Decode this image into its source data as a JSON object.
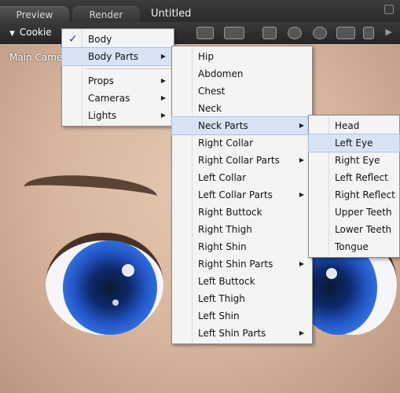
{
  "tabs": {
    "preview": "Preview",
    "render": "Render",
    "document_title": "Untitled"
  },
  "toolbar": {
    "camera_label": "Cookie"
  },
  "viewport": {
    "label": "Main Camera"
  },
  "menu1": {
    "items": [
      {
        "label": "Body",
        "checked": true
      },
      {
        "label": "Body Parts",
        "submenu": true,
        "highlighted": true
      },
      {
        "label": "Props",
        "submenu": true
      },
      {
        "label": "Cameras",
        "submenu": true
      },
      {
        "label": "Lights",
        "submenu": true
      }
    ]
  },
  "menu2": {
    "items": [
      {
        "label": "Hip"
      },
      {
        "label": "Abdomen"
      },
      {
        "label": "Chest"
      },
      {
        "label": "Neck"
      },
      {
        "label": "Neck Parts",
        "submenu": true,
        "highlighted": true
      },
      {
        "label": "Right Collar"
      },
      {
        "label": "Right Collar Parts",
        "submenu": true
      },
      {
        "label": "Left Collar"
      },
      {
        "label": "Left Collar Parts",
        "submenu": true
      },
      {
        "label": "Right Buttock"
      },
      {
        "label": "Right Thigh"
      },
      {
        "label": "Right Shin"
      },
      {
        "label": "Right Shin Parts",
        "submenu": true
      },
      {
        "label": "Left Buttock"
      },
      {
        "label": "Left Thigh"
      },
      {
        "label": "Left Shin"
      },
      {
        "label": "Left Shin Parts",
        "submenu": true
      }
    ]
  },
  "menu3": {
    "items": [
      {
        "label": "Head"
      },
      {
        "label": "Left Eye",
        "highlighted": true
      },
      {
        "label": "Right Eye"
      },
      {
        "label": "Left Reflect"
      },
      {
        "label": "Right Reflect"
      },
      {
        "label": "Upper Teeth"
      },
      {
        "label": "Lower Teeth"
      },
      {
        "label": "Tongue"
      }
    ]
  },
  "icons": {
    "check": "✓",
    "submenu_arrow": "▶",
    "dropdown": "▼",
    "more": "▶"
  },
  "colors": {
    "highlight_bg": "#d8e4f6",
    "menu_bg": "#f4f4f4",
    "check": "#1d3f9a"
  }
}
